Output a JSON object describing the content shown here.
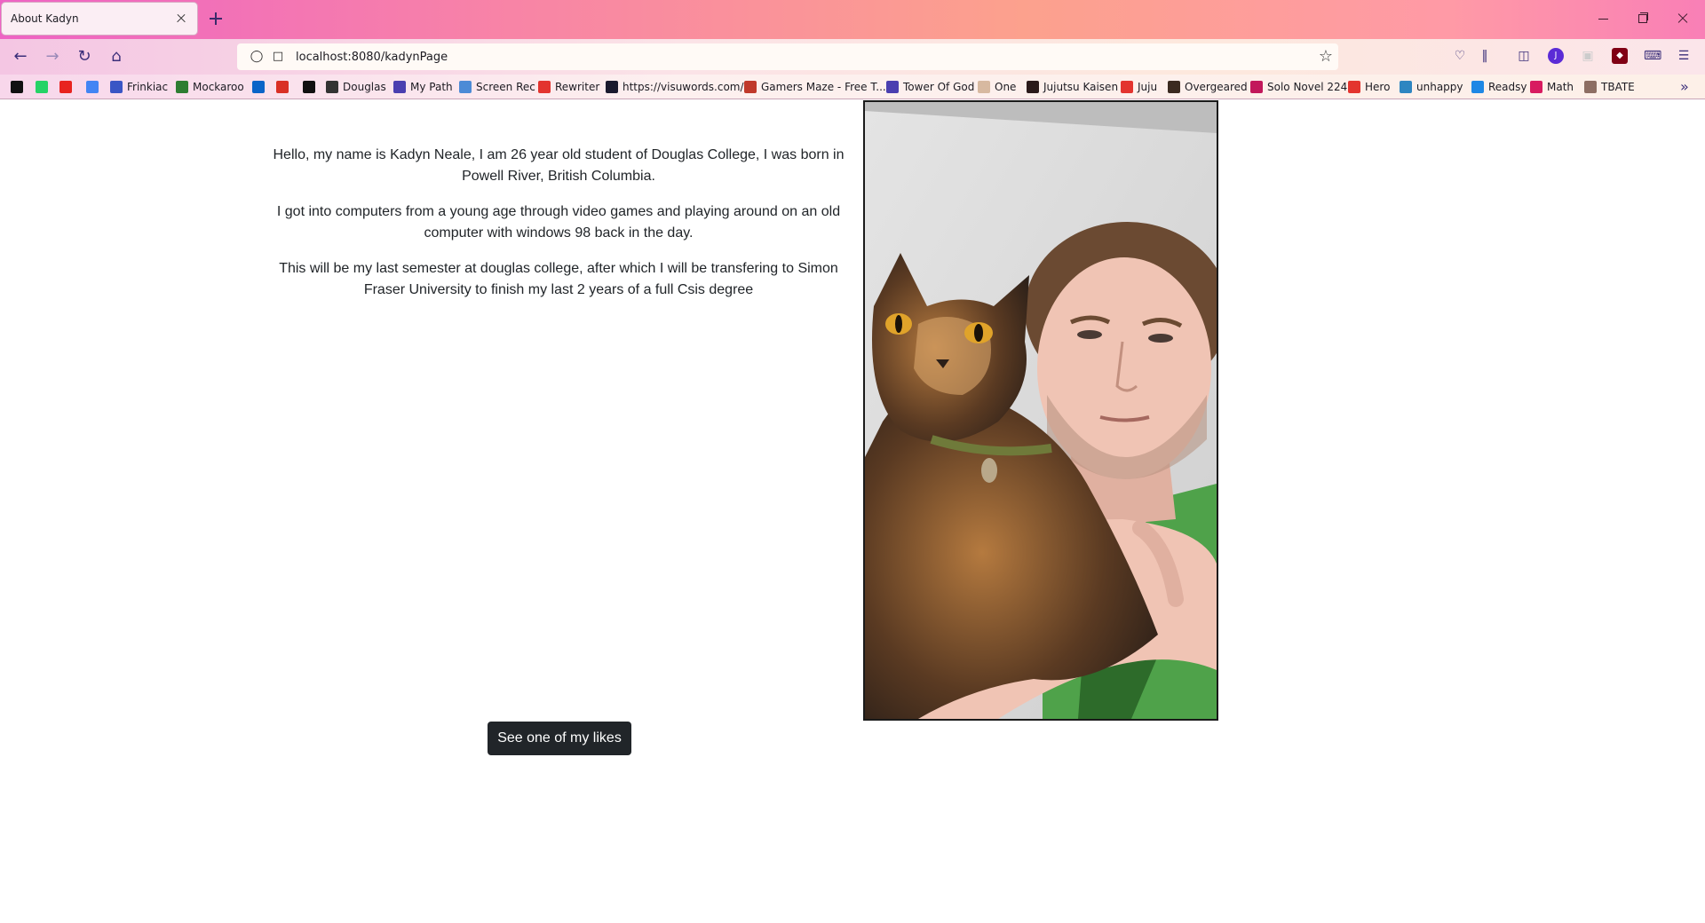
{
  "tab": {
    "title": "About Kadyn"
  },
  "address_bar": {
    "url": "localhost:8080/kadynPage"
  },
  "bookmarks": [
    {
      "label": "",
      "color": "#111111"
    },
    {
      "label": "",
      "color": "#25d366"
    },
    {
      "label": "",
      "color": "#e8231f"
    },
    {
      "label": "",
      "color": "#4285f4"
    },
    {
      "label": "Frinkiac",
      "color": "#3a56c5"
    },
    {
      "label": "Mockaroo",
      "color": "#2e7d32"
    },
    {
      "label": "",
      "color": "#0a64c8"
    },
    {
      "label": "",
      "color": "#d93025"
    },
    {
      "label": "",
      "color": "#111111"
    },
    {
      "label": "Douglas",
      "color": "#333333"
    },
    {
      "label": "My Path",
      "color": "#4a3fb0"
    },
    {
      "label": "Screen Rec",
      "color": "#4c8bd6"
    },
    {
      "label": "Rewriter",
      "color": "#e3342f"
    },
    {
      "label": "https://visuwords.com/",
      "color": "#1a1a2e"
    },
    {
      "label": "Gamers Maze - Free T...",
      "color": "#c0392b"
    },
    {
      "label": "Tower Of God",
      "color": "#4a3fb0"
    },
    {
      "label": "One",
      "color": "#d7b9a0"
    },
    {
      "label": "Jujutsu Kaisen",
      "color": "#2b1a1a"
    },
    {
      "label": "Juju",
      "color": "#e3342f"
    },
    {
      "label": "Overgeared",
      "color": "#3b2a20"
    },
    {
      "label": "Solo Novel 224",
      "color": "#c2185b"
    },
    {
      "label": "Hero",
      "color": "#e3342f"
    },
    {
      "label": "unhappy",
      "color": "#2e86c1"
    },
    {
      "label": "Readsy",
      "color": "#1e88e5"
    },
    {
      "label": "Math",
      "color": "#d81b60"
    },
    {
      "label": "TBATE",
      "color": "#8d6e63"
    }
  ],
  "page": {
    "paragraphs": [
      "Hello, my name is Kadyn Neale, I am 26 year old student of Douglas College, I was born in Powell River, British Columbia.",
      "I got into computers from a young age through video games and playing around on an old computer with windows 98 back in the day.",
      "This will be my last semester at douglas college, after which I will be transfering to Simon Fraser University to finish my last 2 years of a full Csis degree"
    ],
    "likes_button": "See one of my likes"
  },
  "toolbar_icons": {
    "avatar_letter": "J"
  }
}
